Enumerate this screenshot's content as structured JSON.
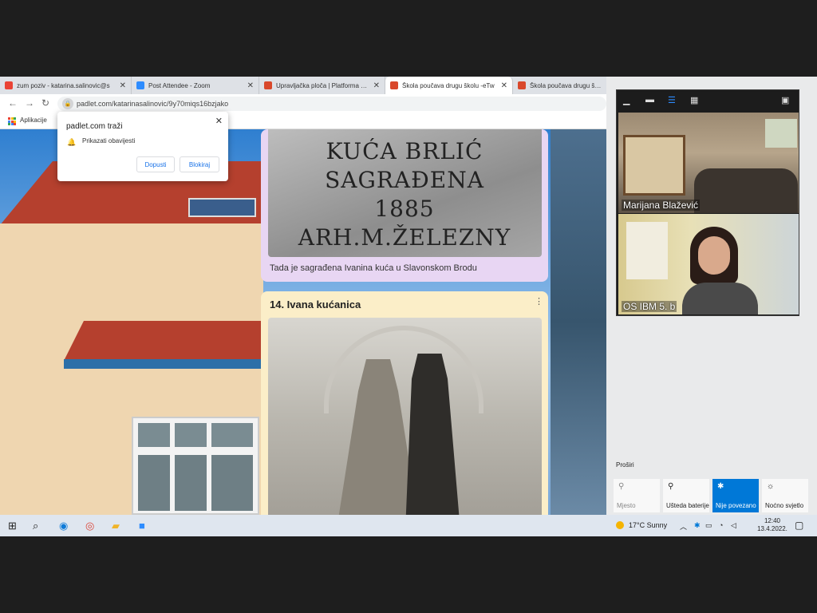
{
  "browser": {
    "tabs": [
      {
        "label": "zum poziv - katarina.salinovic@s",
        "close": "✕",
        "fav_color": "#ea4335"
      },
      {
        "label": "Post Attendee - Zoom",
        "close": "✕",
        "fav_color": "#2d8cff"
      },
      {
        "label": "Upravljačka ploča | Platforma Pad",
        "close": "✕",
        "fav_color": "#d9482b"
      },
      {
        "label": "Škola poučava drugu školu -eTw",
        "close": "✕",
        "fav_color": "#d9482b"
      },
      {
        "label": "Škola poučava drugu školu",
        "close": "",
        "fav_color": "#d9482b"
      }
    ],
    "url": "padlet.com/katarinasalinovic/9y70miqs16bzjako",
    "bookmarks_label": "Aplikacije"
  },
  "permission_popup": {
    "title": "padlet.com traži",
    "message": "Prikazati obavijesti",
    "allow": "Dopusti",
    "block": "Blokiraj",
    "close": "✕"
  },
  "padlet": {
    "card1": {
      "plaque_lines": [
        "KUĆA BRLIĆ",
        "SAGRAĐENA 1885",
        "ARH.M.ŽELEZNY"
      ],
      "caption": "Tada je sagrađena Ivanina kuća u Slavonskom Brodu"
    },
    "card2": {
      "title": "14. Ivana kućanica",
      "menu": "⋮"
    }
  },
  "zoom": {
    "participants": [
      {
        "name": "Marijana Blažević"
      },
      {
        "name": "OS IBM 5. b"
      }
    ]
  },
  "action_center": {
    "expand_label": "Proširi",
    "tiles": [
      {
        "label": "Mjesto",
        "icon": "⚲",
        "state": "off"
      },
      {
        "label": "Ušteda baterije",
        "icon": "⚲",
        "state": "off"
      },
      {
        "label": "Nije povezano",
        "icon": "✱",
        "state": "on"
      },
      {
        "label": "Noćno svjetlo",
        "icon": "☼",
        "state": "off"
      }
    ]
  },
  "taskbar": {
    "weather": "17°C  Sunny",
    "time": "12:40",
    "date": "13.4.2022."
  }
}
